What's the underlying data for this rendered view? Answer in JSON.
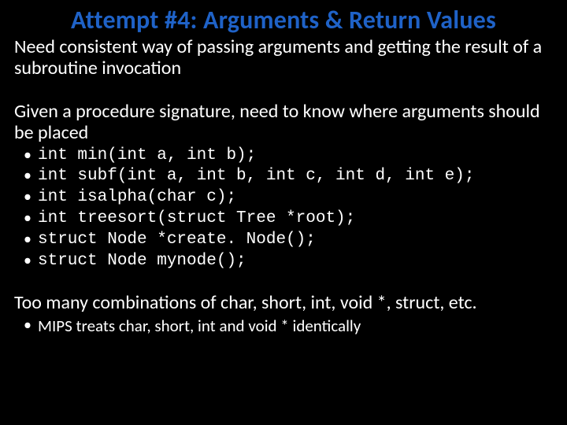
{
  "title": "Attempt #4: Arguments & Return Values",
  "para1": "Need consistent way of passing arguments and getting the result of a subroutine invocation",
  "para2": "Given a procedure signature, need to know where arguments should be placed",
  "code_items": [
    "int min(int a, int b);",
    "int subf(int a, int b, int c, int d, int e);",
    "int isalpha(char c);",
    "int treesort(struct Tree *root);",
    "struct Node *create. Node();",
    "struct Node mynode();"
  ],
  "para3": "Too many combinations of char, short, int, void *, struct, etc.",
  "sub_items": [
    "MIPS treats char, short, int and void * identically"
  ]
}
